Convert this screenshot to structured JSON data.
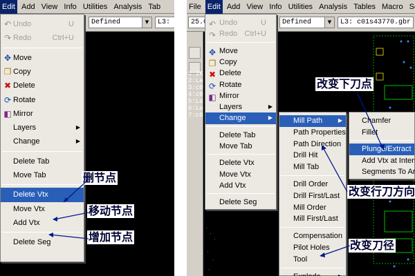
{
  "left_window": {
    "menubar": [
      "Edit",
      "Add",
      "View",
      "Info",
      "Utilities",
      "Analysis",
      "Tab"
    ],
    "combo_text": "Defined",
    "combo2_text": "L3: c",
    "edit_menu": [
      {
        "label": "Undo",
        "shortcut": "U",
        "icon": "undo-icon",
        "disabled": true
      },
      {
        "label": "Redo",
        "shortcut": "Ctrl+U",
        "icon": "redo-icon",
        "disabled": true
      },
      {
        "label": "Move",
        "icon": "move-icon"
      },
      {
        "label": "Copy",
        "icon": "copy-icon"
      },
      {
        "label": "Delete",
        "icon": "delete-icon"
      },
      {
        "label": "Rotate",
        "icon": "rotate-icon"
      },
      {
        "label": "Mirror",
        "icon": "mirror-icon"
      },
      {
        "label": "Layers"
      },
      {
        "label": "Change"
      },
      {
        "label": "Delete Tab"
      },
      {
        "label": "Move Tab"
      },
      {
        "label": "Delete Vtx"
      },
      {
        "label": "Move Vtx"
      },
      {
        "label": "Add Vtx"
      },
      {
        "label": "Delete Seg"
      }
    ],
    "annotations": [
      "删节点",
      "移动节点",
      "增加节点"
    ]
  },
  "right_window": {
    "menubar": [
      "File",
      "Edit",
      "Add",
      "View",
      "Info",
      "Utilities",
      "Analysis",
      "Tables",
      "Macro",
      "Setting"
    ],
    "combo0_text": "25.0",
    "combo_text": "Defined",
    "combo2_text": "L3: c01s43770.gbr",
    "layer_legend": [
      "1:2K",
      "2:La",
      "3:c0",
      "4:c0",
      "5:La",
      "6:La",
      "7:c0"
    ],
    "edit_menu": [
      {
        "label": "Undo",
        "shortcut": "U",
        "icon": "undo-icon",
        "disabled": true
      },
      {
        "label": "Redo",
        "shortcut": "Ctrl+U",
        "icon": "redo-icon",
        "disabled": true
      },
      {
        "label": "Move",
        "icon": "move-icon"
      },
      {
        "label": "Copy",
        "icon": "copy-icon"
      },
      {
        "label": "Delete",
        "icon": "delete-icon"
      },
      {
        "label": "Rotate",
        "icon": "rotate-icon"
      },
      {
        "label": "Mirror",
        "icon": "mirror-icon"
      },
      {
        "label": "Layers"
      },
      {
        "label": "Change"
      },
      {
        "label": "Delete Tab"
      },
      {
        "label": "Move Tab"
      },
      {
        "label": "Delete Vtx"
      },
      {
        "label": "Move Vtx"
      },
      {
        "label": "Add Vtx"
      },
      {
        "label": "Delete Seg"
      }
    ],
    "change_menu": [
      "Mill Path",
      "Path Properties",
      "Path Direction",
      "Drill Hit",
      "Mill Tab",
      "Drill Order",
      "Drill First/Last",
      "Mill Order",
      "Mill First/Last",
      "Compensation",
      "Pilot Holes",
      "Tool",
      "Explode"
    ],
    "millpath_menu": [
      "Chamfer",
      "Fillet",
      "Plunge/Extract",
      "Add Vtx at Inters",
      "Segments To Arc"
    ],
    "annotations": [
      "改变下刀点",
      "改变行刀方向",
      "改变刀径"
    ]
  }
}
